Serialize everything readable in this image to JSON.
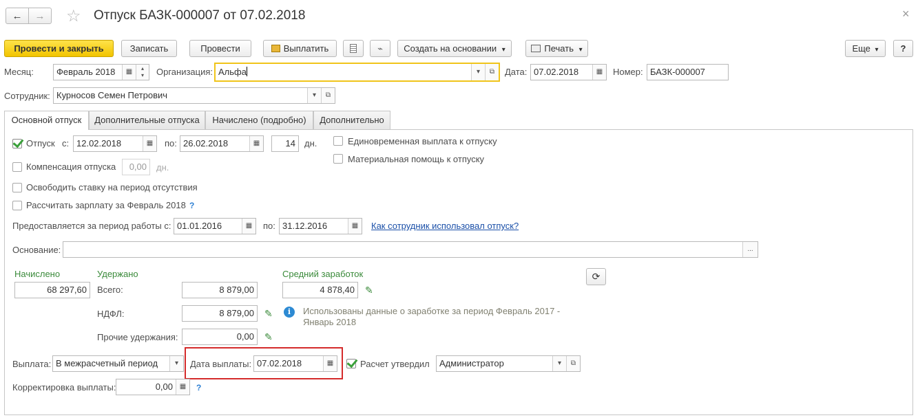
{
  "window": {
    "title": "Отпуск БАЗК-000007 от 07.02.2018"
  },
  "icons": {
    "back": "←",
    "forward": "→",
    "star": "☆",
    "calendar": "▦",
    "dropdown": "▾",
    "open": "⧉",
    "ellipsis": "...",
    "refresh": "⟳",
    "info": "i",
    "pencil": "✎",
    "help": "?"
  },
  "toolbar": {
    "post_close": "Провести и закрыть",
    "save": "Записать",
    "post": "Провести",
    "pay": "Выплатить",
    "create_based": "Создать на основании",
    "print": "Печать",
    "more": "Еще",
    "help": "?"
  },
  "header": {
    "month_label": "Месяц:",
    "month_value": "Февраль 2018",
    "org_label": "Организация:",
    "org_value": "Альфа",
    "date_label": "Дата:",
    "date_value": "07.02.2018",
    "number_label": "Номер:",
    "number_value": "БАЗК-000007",
    "employee_label": "Сотрудник:",
    "employee_value": "Курносов Семен Петрович"
  },
  "tabs": [
    {
      "label": "Основной отпуск",
      "active": true
    },
    {
      "label": "Дополнительные отпуска",
      "active": false
    },
    {
      "label": "Начислено (подробно)",
      "active": false
    },
    {
      "label": "Дополнительно",
      "active": false
    }
  ],
  "main": {
    "vacation_label": "Отпуск",
    "vacation_checked": true,
    "from_label": "с:",
    "from_value": "12.02.2018",
    "to_label": "по:",
    "to_value": "26.02.2018",
    "days_value": "14",
    "days_label": "дн.",
    "one_time_payment": "Единовременная выплата к отпуску",
    "material_help": "Материальная помощь к отпуску",
    "compensation_label": "Компенсация отпуска",
    "compensation_value": "0,00",
    "compensation_unit": "дн.",
    "release_rate": "Освободить ставку на период отсутствия",
    "calc_salary": "Рассчитать зарплату за Февраль 2018",
    "period_label": "Предоставляется за период работы с:",
    "period_from": "01.01.2016",
    "period_to_label": "по:",
    "period_to": "31.12.2016",
    "usage_link": "Как сотрудник использовал отпуск?",
    "basis_label": "Основание:",
    "basis_value": "",
    "accrued_label": "Начислено",
    "accrued_value": "68 297,60",
    "withheld_label": "Удержано",
    "total_label": "Всего:",
    "total_value": "8 879,00",
    "ndfl_label": "НДФЛ:",
    "ndfl_value": "8 879,00",
    "other_label": "Прочие удержания:",
    "other_value": "0,00",
    "avg_label": "Средний заработок",
    "avg_value": "4 878,40",
    "info_text_1": "Использованы данные о заработке за период Февраль 2017 -",
    "info_text_2": "Январь 2018",
    "payment_label": "Выплата:",
    "payment_value": "В межрасчетный период",
    "pay_date_label": "Дата выплаты:",
    "pay_date_value": "07.02.2018",
    "approved_label": "Расчет утвердил",
    "approved_value": "Администратор",
    "correction_label": "Корректировка выплаты:",
    "correction_value": "0,00"
  },
  "colors": {
    "primary_button": "#f2c400",
    "highlight_box": "#d42a2a",
    "green_label": "#3a8a3a",
    "link": "#1a4fa8",
    "org_focus": "#f0c419"
  }
}
